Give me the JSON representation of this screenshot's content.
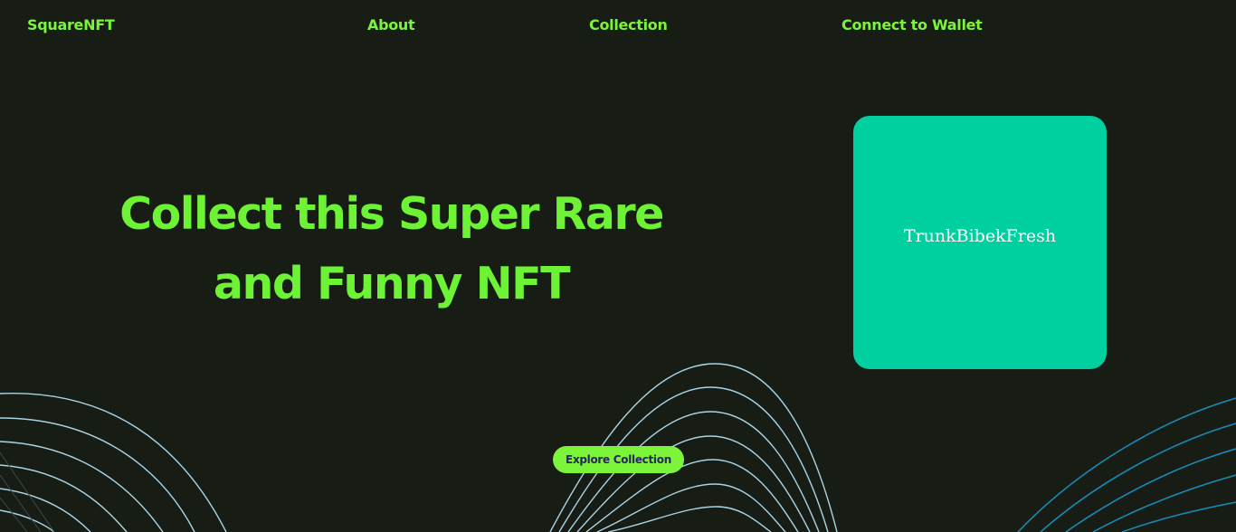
{
  "header": {
    "logo_part1": "Square",
    "logo_part2": "NFT",
    "nav": {
      "about": "About",
      "collection": "Collection",
      "connect": "Connect to Wallet"
    }
  },
  "hero": {
    "title_line1": "Collect this Super Rare",
    "title_line2": "and Funny NFT",
    "cta_label": "Explore Collection"
  },
  "card": {
    "label": "TrunkBibekFresh"
  },
  "colors": {
    "background": "#171c14",
    "accent_green": "#7cf43a",
    "card_teal": "#00d09f",
    "wave_light": "#a9d4e6",
    "wave_blue": "#1a87b5"
  }
}
